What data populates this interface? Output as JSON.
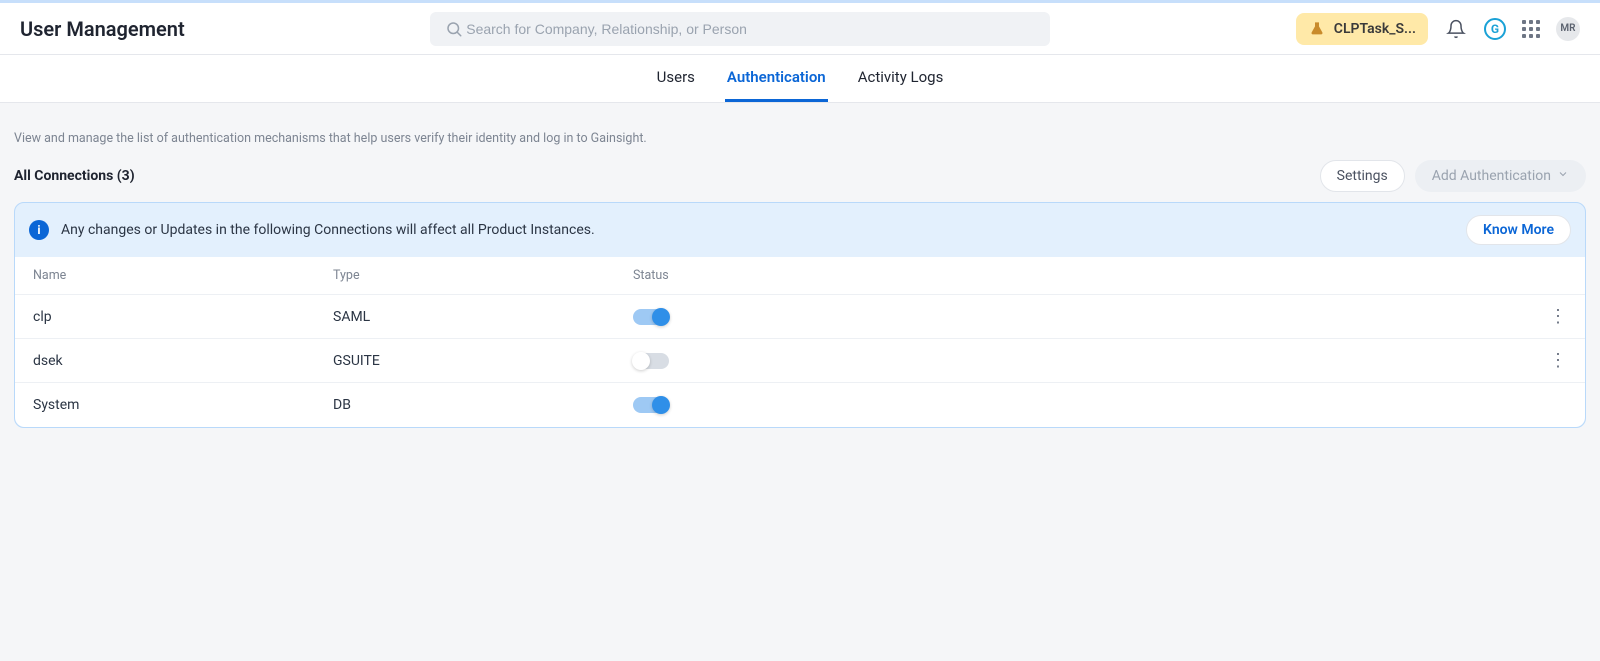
{
  "header": {
    "title": "User Management",
    "search_placeholder": "Search for Company, Relationship, or Person",
    "task_pill": "CLPTask_S...",
    "g_label": "G",
    "avatar_initials": "MR"
  },
  "subnav": {
    "tabs": [
      {
        "label": "Users",
        "active": false
      },
      {
        "label": "Authentication",
        "active": true
      },
      {
        "label": "Activity Logs",
        "active": false
      }
    ]
  },
  "page": {
    "help_text": "View and manage the list of authentication mechanisms that help users verify their identity and log in to Gainsight.",
    "section_title": "All Connections (3)",
    "settings_label": "Settings",
    "add_auth_label": "Add Authentication"
  },
  "banner": {
    "info_char": "i",
    "text": "Any changes or Updates in the following Connections will affect all Product Instances.",
    "know_more": "Know More"
  },
  "table": {
    "columns": {
      "name": "Name",
      "type": "Type",
      "status": "Status"
    },
    "rows": [
      {
        "name": "clp",
        "type": "SAML",
        "enabled": true,
        "menu": true
      },
      {
        "name": "dsek",
        "type": "GSUITE",
        "enabled": false,
        "menu": true
      },
      {
        "name": "System",
        "type": "DB",
        "enabled": true,
        "menu": false
      }
    ]
  }
}
